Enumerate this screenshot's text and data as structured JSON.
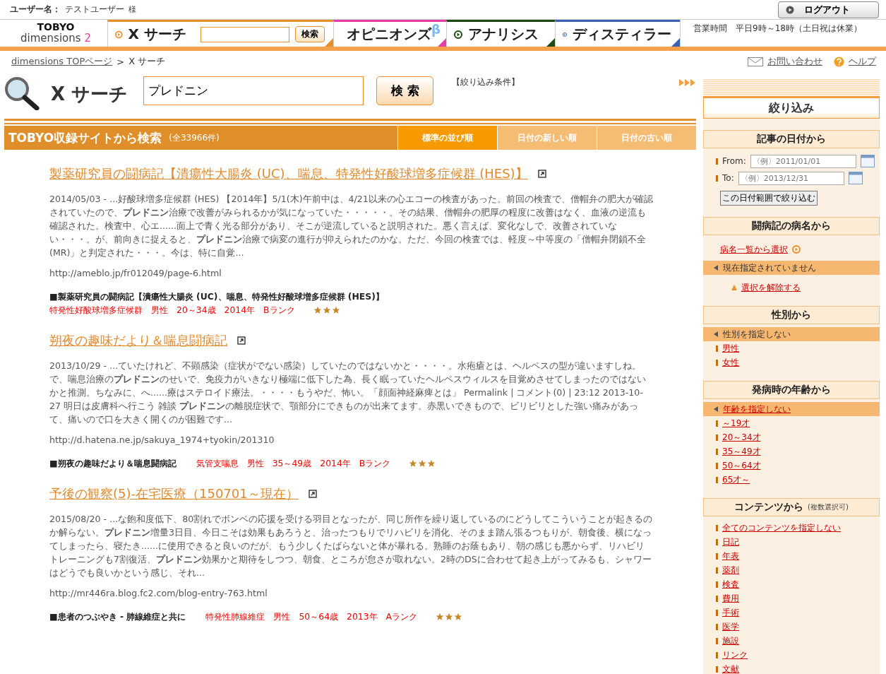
{
  "user_bar": {
    "label": "ユーザー名：",
    "name": "テストユーザー",
    "suffix": "様",
    "logout": "ログアウト"
  },
  "logo": {
    "brand": "TOBYO",
    "product": "dimensions",
    "version": "2"
  },
  "nav_tabs": [
    {
      "kind": "search",
      "label": "X サーチ",
      "color": "#e8912a",
      "button": "検索"
    },
    {
      "kind": "plain",
      "label": "オピニオンズ",
      "beta": "β",
      "color": "#e83ca8"
    },
    {
      "kind": "plain",
      "label": "アナリシス",
      "color": "#1f4a12"
    },
    {
      "kind": "plain",
      "label": "ディスティラー",
      "color": "#3a62b0"
    }
  ],
  "hours": "営業時間　平日9時～18時（土日祝は休業）",
  "breadcrumb": {
    "home": "dimensions TOPページ",
    "separator": ">",
    "current": "X サーチ"
  },
  "header_links": [
    {
      "kind": "mail",
      "label": "お問い合わせ"
    },
    {
      "kind": "help",
      "label": "ヘルプ"
    }
  ],
  "search": {
    "title": "X サーチ",
    "value": "プレドニン",
    "button": "検 索",
    "filter_label": "【絞り込み条件】"
  },
  "results_header": {
    "title": "TOBYO収録サイトから検索",
    "count": "(全33966件)",
    "sort_tabs": [
      {
        "label": "標準の並び順",
        "selected": true
      },
      {
        "label": "日付の新しい順",
        "selected": false
      },
      {
        "label": "日付の古い順",
        "selected": false
      }
    ]
  },
  "results": [
    {
      "title": "製薬研究員の闘病記【潰瘍性大腸炎 (UC)、喘息、特発性好酸球増多症候群 (HES)】",
      "snippet": "2014/05/03 - ...好酸球増多症候群 (HES) 【2014年】5/1(木)午前中は、4/21以来の心エコーの検査があった。前回の検査で、僧帽弁の肥大が確認されていたので、**プレドニン**治療で改善がみられるかが気になっていた・・・・・。その結果、僧帽弁の肥厚の程度に改善はなく、血液の逆流も確認された。検査中、心エ......面上で青く光る部分があり、そこが逆流していると説明された。悪く言えば、変化なしで、改善されていない・・・。が、前向きに捉えると、**プレドニン**治療で病変の進行が抑えられたのかな。ただ、今回の検査では、軽度～中等度の「僧帽弁閉鎖不全(MR)」と判定された・・・。今は、特に自覚...",
      "url": "http://ameblo.jp/fr012049/page-6.html",
      "source": "■製薬研究員の闘病記【潰瘍性大腸炎 (UC)、喘息、特発性好酸球増多症候群 (HES)】",
      "tags": "特発性好酸球増多症候群　男性　20～34歳　2014年　Bランク",
      "stars": 3
    },
    {
      "title": "朔夜の趣味だより＆喘息闘病記",
      "snippet": "2013/10/29 - ...ていたけれど、不顕感染（症状がでない感染）していたのではないかと・・・・。水疱瘡とは、ヘルペスの型が違いますしね。で、喘息治療の**プレドニン**のせいで、免疫力がいきなり極端に低下した為、長く眠っていたヘルペスウィルスを目覚めさせてしまったのではないかと推測。ちなみに、へ......療はステロイド療法。・・・・もうやだ、怖い。「顔面神経麻痺とは」 Permalink | コメント(0) | 23:12 2013-10-27 明日は皮膚科へ行こう 雑談 **プレドニン**の離脱症状で、顎部分にできものが出来てます。赤黒いできもので、ビリビリとした強い痛みがあって、痛いので口を大きく開くのが困難です...",
      "url": "http://d.hatena.ne.jp/sakuya_1974+tyokin/201310",
      "source": "■朔夜の趣味だより＆喘息闘病記",
      "tags": "気管支喘息　男性　35～49歳　2014年　Bランク",
      "stars": 3
    },
    {
      "title": "予後の観察(5)-在宅医療（150701～現在）",
      "snippet": "2015/08/20 - ...な飽和度低下、80割れでボンベの応援を受ける羽目となったが、同じ所作を繰り返しているのにどうしてこういうことが起きるのか解らない。**プレドニン**増量3日目、今日こそは効果もあろうと、治ったつもりでリハビリを消化、そのまま踏ん張るつもりが、朝食後、横になってしまったら、寝たき......に使用できると良いのだが、もう少しくたばらないと体が暴れる。熟睡のお蔭もあり、朝の感じも悪からず、リハビリトレーニングも7割復活、**プレドニン**効果かと期待をしつつ、朝食、ところが怠さが取れない。2時のDSに合わせて起き上がってみるも、シャワーはどうでも良いかという感じ、それ...",
      "url": "http://mr446ra.blog.fc2.com/blog-entry-763.html",
      "source": "■患者のつぶやき - 肺線維症と共に",
      "tags": "特発性肺線維症　男性　50～64歳　2013年　Aランク",
      "stars": 3
    }
  ],
  "sidebar": {
    "title": "絞り込み",
    "sections": [
      {
        "kind": "date",
        "title": "記事の日付から",
        "from_label": "From:",
        "from_placeholder": "〈例〉2011/01/01",
        "to_label": "To:",
        "to_placeholder": "〈例〉2013/12/31",
        "button": "この日付範囲で絞り込む"
      },
      {
        "kind": "disease",
        "title": "闘病記の病名から",
        "link": "病名一覧から選択",
        "current": "現在指定されていません",
        "clear": "選択を解除する"
      },
      {
        "kind": "list",
        "title": "性別から",
        "current": "性別を指定しない",
        "current_link": false,
        "items": [
          "男性",
          "女性"
        ]
      },
      {
        "kind": "list",
        "title": "発病時の年齢から",
        "current": "年齢を指定しない",
        "current_link": true,
        "items": [
          "～19才",
          "20～34才",
          "35～49才",
          "50～64才",
          "65才～"
        ]
      },
      {
        "kind": "list",
        "title": "コンテンツから",
        "note": "(複数選択可)",
        "items": [
          "全てのコンテンツを指定しない",
          "日記",
          "年表",
          "薬剤",
          "検査",
          "費用",
          "手術",
          "医学",
          "施設",
          "リンク",
          "文献"
        ]
      }
    ]
  }
}
